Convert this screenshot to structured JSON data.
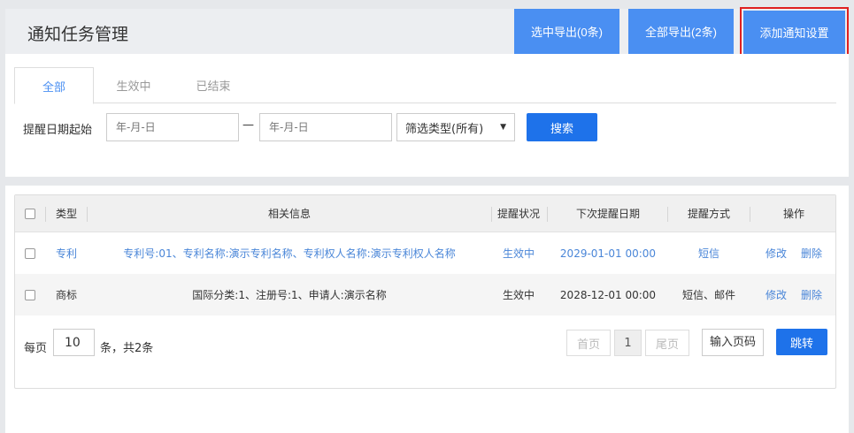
{
  "header": {
    "title": "通知任务管理",
    "export_selected_label": "选中导出(0条)",
    "export_all_label": "全部导出(2条)",
    "add_setting_label": "添加通知设置"
  },
  "tabs": [
    {
      "label": "全部",
      "active": true
    },
    {
      "label": "生效中",
      "active": false
    },
    {
      "label": "已结束",
      "active": false
    }
  ],
  "filter": {
    "date_label": "提醒日期起始",
    "start_placeholder": "年-月-日",
    "separator": "—",
    "end_placeholder": "年-月-日",
    "type_select_value": "筛选类型(所有)",
    "search_label": "搜索"
  },
  "table": {
    "columns": [
      "类型",
      "相关信息",
      "提醒状况",
      "下次提醒日期",
      "提醒方式",
      "操作"
    ],
    "rows": [
      {
        "type": "专利",
        "info": "专利号:01、专利名称:演示专利名称、专利权人名称:演示专利权人名称",
        "status": "生效中",
        "next_date": "2029-01-01 00:00",
        "method": "短信",
        "edit": "修改",
        "delete": "删除"
      },
      {
        "type": "商标",
        "info": "国际分类:1、注册号:1、申请人:演示名称",
        "status": "生效中",
        "next_date": "2028-12-01 00:00",
        "method": "短信、邮件",
        "edit": "修改",
        "delete": "删除"
      }
    ]
  },
  "pagination": {
    "per_page_label": "每页",
    "per_page_value": "10",
    "per_page_suffix": "条，共2条",
    "first_label": "首页",
    "current_page": "1",
    "last_label": "尾页",
    "goto_placeholder": "输入页码",
    "jump_label": "跳转"
  },
  "colors": {
    "primary": "#4a8ff2",
    "primary_dark": "#1e72ea",
    "link": "#4a86d8",
    "highlight_border": "#e02020"
  }
}
